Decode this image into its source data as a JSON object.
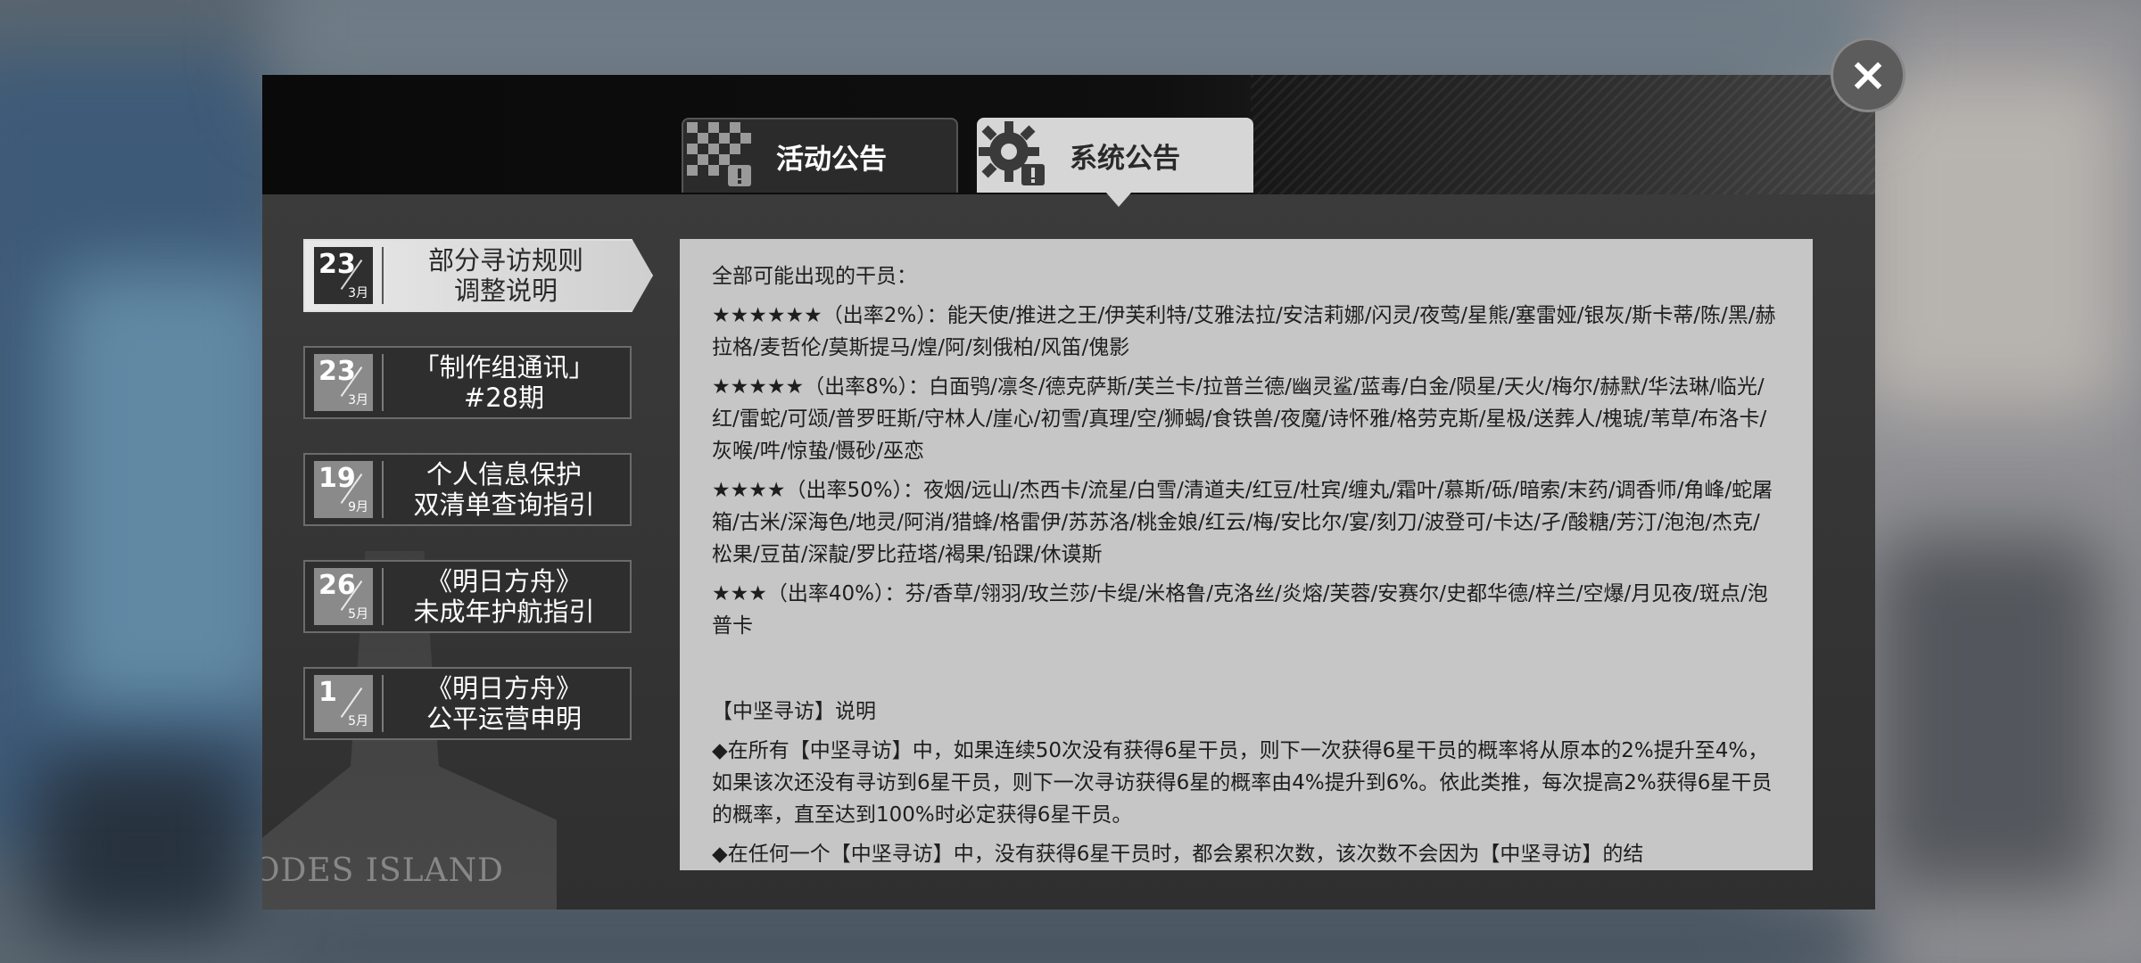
{
  "tabs": [
    {
      "label": "活动公告",
      "icon": "checkered-flag-alert-icon",
      "active": false
    },
    {
      "label": "系统公告",
      "icon": "gear-alert-icon",
      "active": true
    }
  ],
  "close_icon": "×",
  "announcements": [
    {
      "day": "23",
      "month": "3月",
      "title": "部分寻访规则\n调整说明",
      "selected": true
    },
    {
      "day": "23",
      "month": "3月",
      "title": "「制作组通讯」\n#28期",
      "selected": false
    },
    {
      "day": "19",
      "month": "9月",
      "title": "个人信息保护\n双清单查询指引",
      "selected": false
    },
    {
      "day": "26",
      "month": "5月",
      "title": "《明日方舟》\n未成年护航指引",
      "selected": false
    },
    {
      "day": "1",
      "month": "5月",
      "title": "《明日方舟》\n公平运营申明",
      "selected": false
    }
  ],
  "watermark": "ODES ISLAND",
  "content": {
    "heading": "全部可能出现的干员：",
    "six_star": "★★★★★★（出率2%）：能天使/推进之王/伊芙利特/艾雅法拉/安洁莉娜/闪灵/夜莺/星熊/塞雷娅/银灰/斯卡蒂/陈/黑/赫拉格/麦哲伦/莫斯提马/煌/阿/刻俄柏/风笛/傀影",
    "five_star": "★★★★★（出率8%）：白面鸮/凛冬/德克萨斯/芙兰卡/拉普兰德/幽灵鲨/蓝毒/白金/陨星/天火/梅尔/赫默/华法琳/临光/红/雷蛇/可颂/普罗旺斯/守林人/崖心/初雪/真理/空/狮蝎/食铁兽/夜魔/诗怀雅/格劳克斯/星极/送葬人/槐琥/苇草/布洛卡/灰喉/吽/惊蛰/慑砂/巫恋",
    "four_star": "★★★★（出率50%）：夜烟/远山/杰西卡/流星/白雪/清道夫/红豆/杜宾/缠丸/霜叶/慕斯/砾/暗索/末药/调香师/角峰/蛇屠箱/古米/深海色/地灵/阿消/猎蜂/格雷伊/苏苏洛/桃金娘/红云/梅/安比尔/宴/刻刀/波登可/卡达/孑/酸糖/芳汀/泡泡/杰克/松果/豆苗/深靛/罗比菈塔/褐果/铅踝/休谟斯",
    "three_star": "★★★（出率40%）：芬/香草/翎羽/玫兰莎/卡缇/米格鲁/克洛丝/炎熔/芙蓉/安赛尔/史都华德/梓兰/空爆/月见夜/斑点/泡普卡",
    "section_title": "【中坚寻访】说明",
    "rule1": "◆在所有【中坚寻访】中，如果连续50次没有获得6星干员，则下一次获得6星干员的概率将从原本的2%提升至4%，如果该次还没有寻访到6星干员，则下一次寻访获得6星的概率由4%提升到6%。依此类推，每次提高2%获得6星干员的概率，直至达到100%时必定获得6星干员。",
    "rule2": "◆在任何一个【中坚寻访】中，没有获得6星干员时，都会累积次数，该次数不会因为【中坚寻访】的结"
  }
}
